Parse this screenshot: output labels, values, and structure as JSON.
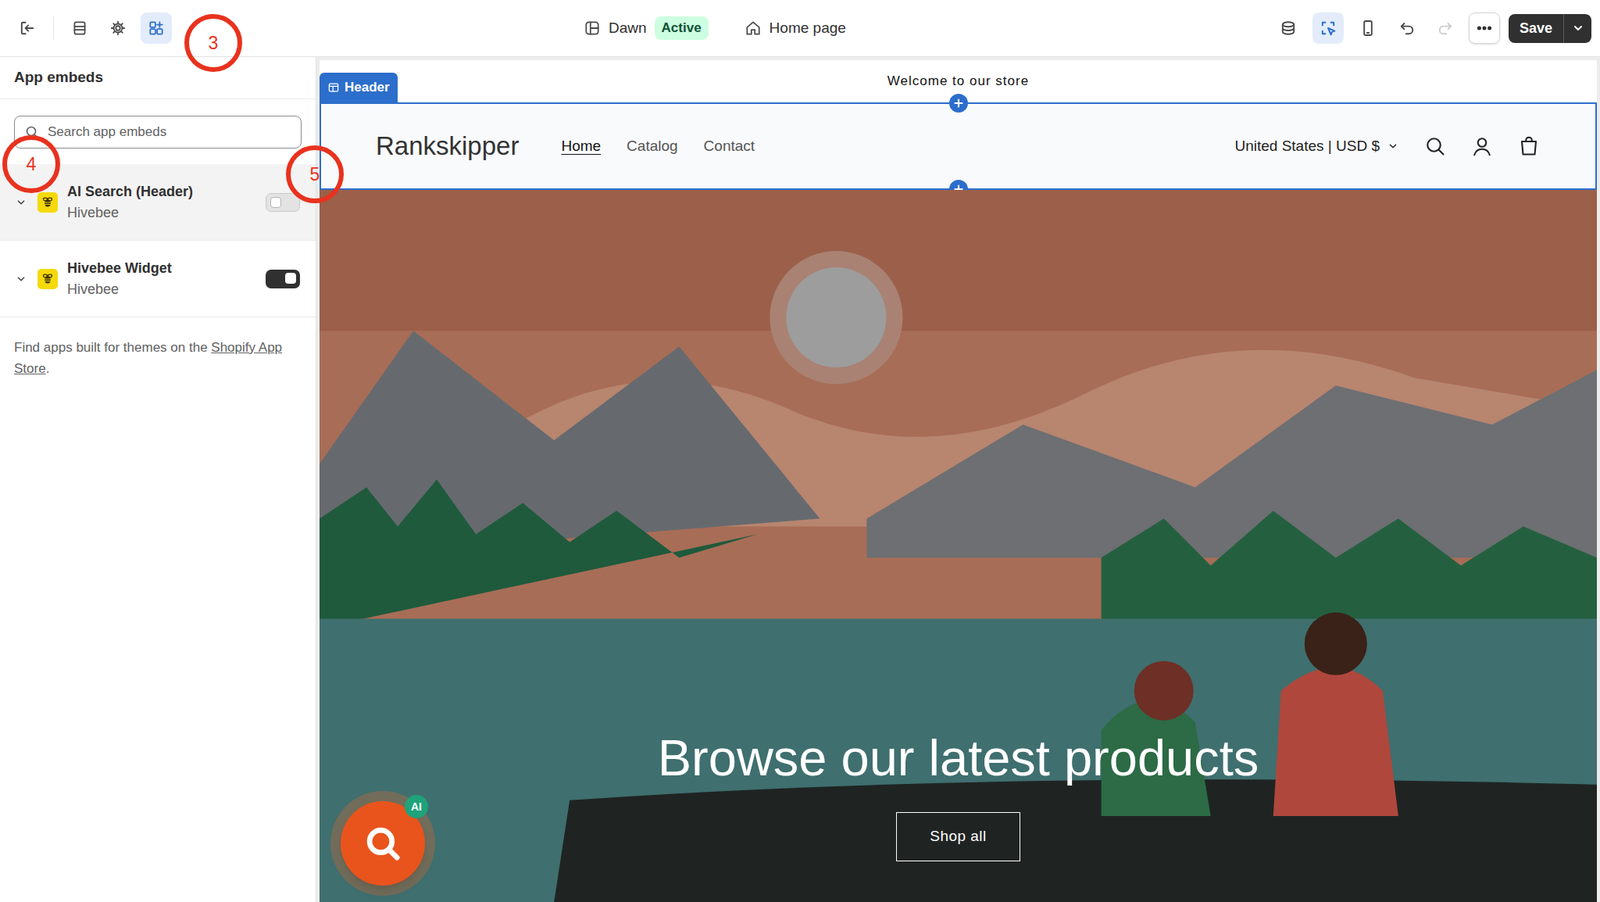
{
  "editor": {
    "theme": "Dawn",
    "theme_status": "Active",
    "page": "Home page",
    "save": "Save"
  },
  "sidebar_tabs": [
    {
      "kind": "sections",
      "selected": false
    },
    {
      "kind": "settings",
      "selected": false
    },
    {
      "kind": "embeds",
      "selected": true
    }
  ],
  "view_tools": [
    {
      "kind": "layers",
      "selected": false
    },
    {
      "kind": "inspect",
      "selected": true
    },
    {
      "kind": "mobile",
      "selected": false
    }
  ],
  "history": [
    {
      "kind": "undo",
      "disabled": false
    },
    {
      "kind": "redo",
      "disabled": true
    }
  ],
  "annotations": [
    {
      "label": "3"
    },
    {
      "label": "4"
    },
    {
      "label": "5"
    }
  ],
  "panel": {
    "title": "App embeds",
    "search": {
      "placeholder": "Search app embeds"
    },
    "embeds": [
      {
        "name": "AI Search (Header)",
        "vendor": "Hivebee",
        "on": false,
        "highlighted": true
      },
      {
        "name": "Hivebee Widget",
        "vendor": "Hivebee",
        "on": true,
        "highlighted": false
      }
    ],
    "footer": {
      "text": "Find apps built for themes on the ",
      "link": "Shopify App Store",
      "end": "."
    }
  },
  "preview": {
    "announcement": "Welcome to our store",
    "section_tag": "Header",
    "store_name": "Rankskipper",
    "nav": [
      {
        "label": "Home",
        "selected": true
      },
      {
        "label": "Catalog",
        "selected": false
      },
      {
        "label": "Contact",
        "selected": false
      }
    ],
    "currency": "United States | USD $",
    "hero": {
      "heading": "Browse our latest products",
      "button": "Shop all"
    },
    "ai_badge": "AI"
  }
}
